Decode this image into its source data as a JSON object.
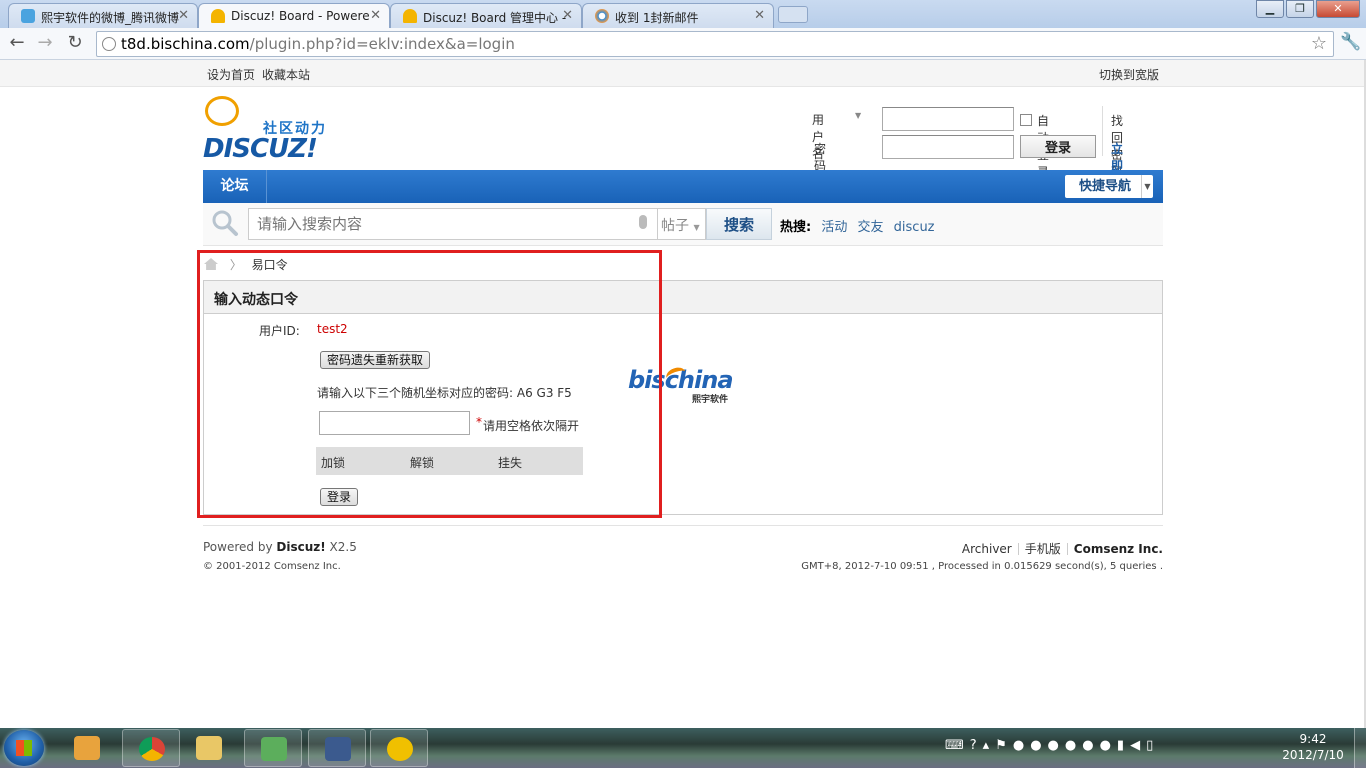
{
  "browser": {
    "tabs": [
      {
        "label": "熙宇软件的微博_腾讯微博",
        "icon": "tencent-weibo-icon",
        "active": false
      },
      {
        "label": "Discuz! Board - Powere",
        "icon": "discuz-icon",
        "active": true
      },
      {
        "label": "Discuz! Board 管理中心 -",
        "icon": "discuz-icon",
        "active": false
      },
      {
        "label": "收到 1封新邮件",
        "icon": "mail-icon",
        "active": false
      }
    ],
    "url_host": "t8d.bischina.com",
    "url_path": "/plugin.php?id=eklv:index&a=login"
  },
  "topbar": {
    "set_home": "设为首页",
    "bookmark": "收藏本站",
    "switch_width": "切换到宽版"
  },
  "logo": {
    "tagline": "社区动力",
    "brand": "DISCUZ!"
  },
  "login": {
    "username_label": "用户名",
    "password_label": "密码",
    "auto_login": "自动登录",
    "login_button": "登录",
    "forgot_password": "找回密码",
    "register": "立即注册"
  },
  "nav": {
    "forum": "论坛",
    "quick_nav": "快捷导航"
  },
  "search": {
    "placeholder": "请输入搜索内容",
    "type": "帖子",
    "button": "搜索",
    "hot_label": "热搜:",
    "hot_items": [
      "活动",
      "交友",
      "discuz"
    ]
  },
  "breadcrumb": {
    "current": "易口令"
  },
  "panel": {
    "title": "输入动态口令",
    "user_id_label": "用户ID:",
    "user_id_value": "test2",
    "reacquire_button": "密码遗失重新获取",
    "instruction": "请输入以下三个随机坐标对应的密码: A6 G3 F5",
    "required_mark": "*",
    "hint": "请用空格依次隔开",
    "ops": [
      "加锁",
      "解锁",
      "挂失"
    ],
    "submit_button": "登录"
  },
  "bischina_logo": {
    "brand": "bischina",
    "subtitle": "熙宇软件"
  },
  "footer": {
    "powered_prefix": "Powered by ",
    "powered_brand": "Discuz!",
    "powered_version": " X2.5",
    "copyright": "© 2001-2012 Comsenz Inc.",
    "archiver": "Archiver",
    "mobile": "手机版",
    "company": "Comsenz Inc.",
    "stats": "GMT+8, 2012-7-10 09:51 , Processed in 0.015629 second(s), 5 queries ."
  },
  "taskbar": {
    "time": "9:42",
    "date": "2012/7/10"
  },
  "colors": {
    "nav_blue": "#1962b7",
    "highlight_red": "#e01f1f",
    "user_id_red": "#cc0000",
    "link_blue": "#336699"
  }
}
